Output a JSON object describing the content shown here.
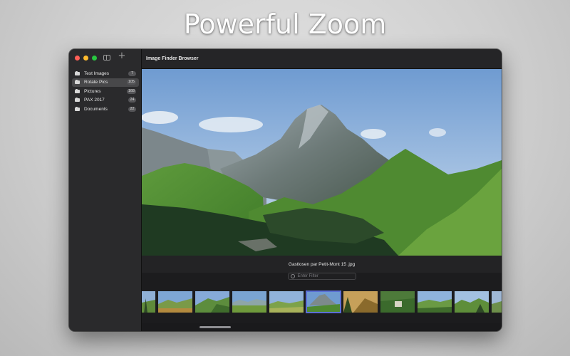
{
  "headline": "Powerful Zoom",
  "window": {
    "title": "Image Finder Browser"
  },
  "sidebar": {
    "folders": [
      {
        "label": "Test Images",
        "count": "7"
      },
      {
        "label": "Rotate Pics",
        "count": "105",
        "selected": true
      },
      {
        "label": "Pictures",
        "count": "168"
      },
      {
        "label": "PAX 2017",
        "count": "24"
      },
      {
        "label": "Documents",
        "count": "22"
      }
    ]
  },
  "viewer": {
    "caption": "Gastlosen par Petit-Mont 15 .jpg",
    "filter_placeholder": "Enter Filter"
  },
  "icons": {
    "folder": "tray-icon",
    "sidebar_toggle": "sidebar-toggle-icon",
    "add": "plus-icon",
    "filter": "gear-icon"
  },
  "colors": {
    "close": "#ff5f57",
    "minimize": "#febc2e",
    "zoom": "#28c840",
    "selection_accent": "#5b6fd6"
  }
}
